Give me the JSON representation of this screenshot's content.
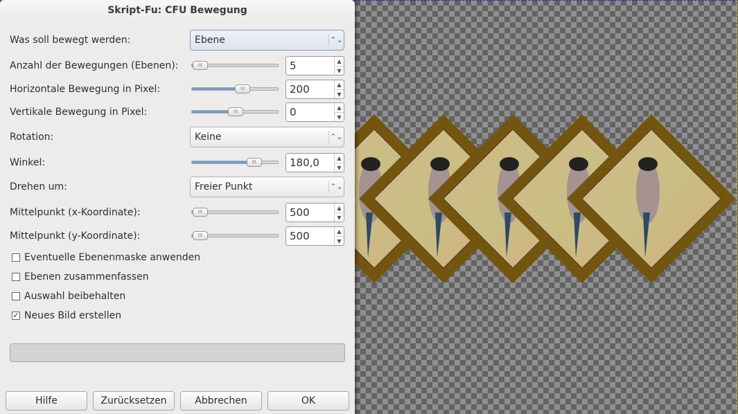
{
  "dialog": {
    "title": "Skript-Fu: CFU Bewegung"
  },
  "fields": {
    "what": {
      "label": "Was soll bewegt werden:",
      "value": "Ebene"
    },
    "count": {
      "label": "Anzahl der Bewegungen (Ebenen):",
      "value": "5",
      "slider_fraction": 0.0
    },
    "hmove": {
      "label": "Horizontale Bewegung in Pixel:",
      "value": "200",
      "slider_fraction": 0.6
    },
    "vmove": {
      "label": "Vertikale Bewegung in Pixel:",
      "value": "0",
      "slider_fraction": 0.5
    },
    "rotation": {
      "label": "Rotation:",
      "value": "Keine"
    },
    "angle": {
      "label": "Winkel:",
      "value": "180,0",
      "slider_fraction": 0.76
    },
    "pivot": {
      "label": "Drehen um:",
      "value": "Freier Punkt"
    },
    "cx": {
      "label": "Mittelpunkt (x-Koordinate):",
      "value": "500",
      "slider_fraction": 0.0
    },
    "cy": {
      "label": "Mittelpunkt (y-Koordinate):",
      "value": "500",
      "slider_fraction": 0.0
    }
  },
  "checkboxes": [
    {
      "label": "Eventuelle Ebenenmaske anwenden",
      "checked": false
    },
    {
      "label": "Ebenen zusammenfassen",
      "checked": false
    },
    {
      "label": "Auswahl beibehalten",
      "checked": false
    },
    {
      "label": "Neues Bild erstellen",
      "checked": true
    }
  ],
  "progress": {
    "fraction": 0
  },
  "buttons": {
    "help": "Hilfe",
    "reset": "Zurücksetzen",
    "cancel": "Abbrechen",
    "ok": "OK"
  },
  "colors": {
    "frame": "#735510",
    "accent": "#6e9bd2"
  }
}
